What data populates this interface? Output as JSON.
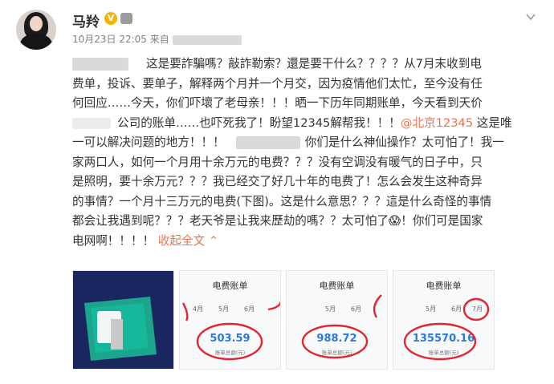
{
  "post": {
    "author_name": "马羚",
    "timestamp": "10月23日 22:05",
    "source_prefix": "来自",
    "lines": [
      {
        "segments": [
          {
            "t": "这是要詐騙嗎？敲詐勒索？還是要干什么？？？？从7月末收到电",
            "c": "normal"
          }
        ]
      },
      {
        "segments": [
          {
            "t": "费单，投诉、要单子，解释两个月并一个月交，因为疫情他们太忙，至今没有任",
            "c": "normal"
          }
        ]
      },
      {
        "segments": [
          {
            "t": "何回应……今天，你们吓壞了老母亲！！！晒一下历年同期账单，今天看到天价",
            "c": "normal"
          }
        ]
      },
      {
        "segments": [
          {
            "t": "公司的账单……也吓死我了！盼望12345解帮我！！！",
            "c": "normal"
          },
          {
            "t": "@北京12345",
            "c": "link"
          },
          {
            "t": " 这是唯",
            "c": "normal"
          }
        ]
      },
      {
        "segments": [
          {
            "t": "一可以解决问题的地方！！！",
            "c": "normal"
          },
          {
            "t": "",
            "c": "blur"
          },
          {
            "t": "你们是什么神仙操作？太可怕了！我一",
            "c": "normal"
          }
        ]
      },
      {
        "segments": [
          {
            "t": "家两口人，如何一个月用十余万元的电费？？？没有空调没有暖气的日子中，只",
            "c": "normal"
          }
        ]
      },
      {
        "segments": [
          {
            "t": "是照明，要十余万元？？？我已经交了好几十年的电费了！怎么会发生这种奇异",
            "c": "normal"
          }
        ]
      },
      {
        "segments": [
          {
            "t": "的事情？一个月十三万元的电费(下图)。这是什么意思？？？這是什么奇怪的事情",
            "c": "normal"
          }
        ]
      },
      {
        "segments": [
          {
            "t": "都会让我遇到呢？？？老天爷是让我来歷劫的嗎？？太可怕了",
            "c": "normal"
          },
          {
            "t": "😱",
            "c": "emoji"
          },
          {
            "t": "！你们可是国家",
            "c": "normal"
          }
        ]
      },
      {
        "segments": [
          {
            "t": "电网啊！！！！ ",
            "c": "normal"
          },
          {
            "t": "收起全文",
            "c": "expand"
          },
          {
            "t": " ⌃",
            "c": "expand"
          }
        ]
      }
    ]
  },
  "bills": [
    {
      "title": "电费账单",
      "months": [
        "4月",
        "5月",
        "6月"
      ],
      "amount": "503.59",
      "caption": "账单总额(元)"
    },
    {
      "title": "电费账单",
      "months": [
        "5月",
        "6月"
      ],
      "amount": "988.72",
      "caption": "账单总额(元)"
    },
    {
      "title": "电费账单",
      "months": [
        "5月",
        "6月",
        "7月"
      ],
      "amount": "135570.16",
      "caption": "账单总额(元)"
    }
  ],
  "colors": {
    "accent": "#eb7350",
    "amount": "#2a7bd6",
    "circle": "#e0262f",
    "vbadge": "#f5b400"
  }
}
